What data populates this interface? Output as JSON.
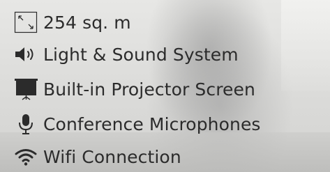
{
  "features": {
    "items": [
      {
        "icon": "area-expand-icon",
        "label": "254 sq. m"
      },
      {
        "icon": "speaker-icon",
        "label": "Light & Sound System"
      },
      {
        "icon": "projector-screen-icon",
        "label": "Built-in Projector Screen"
      },
      {
        "icon": "microphone-icon",
        "label": "Conference Microphones"
      },
      {
        "icon": "wifi-icon",
        "label": "Wifi Connection"
      }
    ]
  },
  "colors": {
    "text": "#2b2b2b",
    "icon": "#2b2b2b",
    "background": "#d9d9d7"
  }
}
